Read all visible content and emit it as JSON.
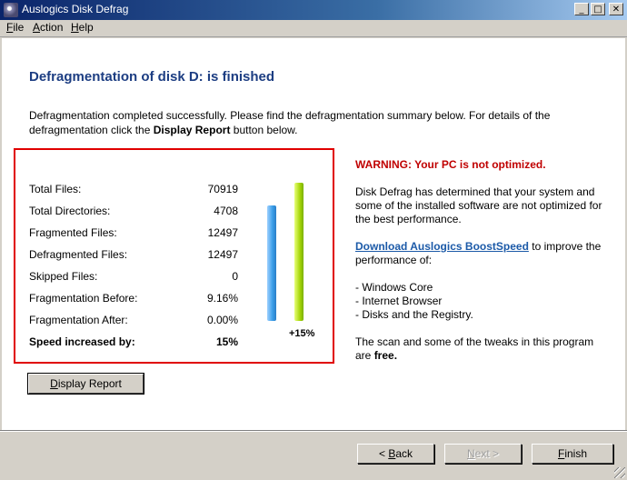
{
  "window": {
    "title": "Auslogics Disk Defrag",
    "minimize_glyph": "_",
    "maximize_glyph": "□",
    "close_glyph": "✕"
  },
  "menu": [
    {
      "first": "F",
      "rest": "ile"
    },
    {
      "first": "A",
      "rest": "ction"
    },
    {
      "first": "H",
      "rest": "elp"
    }
  ],
  "page": {
    "heading": "Defragmentation of disk D: is finished",
    "intro_text": "Defragmentation completed successfully. Please find the defragmentation summary below. For details of the defragmentation click the ",
    "intro_bold": "Display Report",
    "intro_end": " button below."
  },
  "stats": [
    {
      "label": "Total Files:",
      "value": "70919"
    },
    {
      "label": "Total Directories:",
      "value": "4708"
    },
    {
      "label": "Fragmented Files:",
      "value": "12497"
    },
    {
      "label": "Defragmented Files:",
      "value": "12497"
    },
    {
      "label": "Skipped Files:",
      "value": "0"
    },
    {
      "label": "Fragmentation Before:",
      "value": "9.16%"
    },
    {
      "label": "Fragmentation After:",
      "value": "0.00%"
    },
    {
      "label": "Speed increased by:",
      "value": "15%"
    }
  ],
  "bars": {
    "label": "+15%",
    "before_color": "#3a9ee8",
    "after_color": "#a6d60a"
  },
  "warning": {
    "title": "WARNING: Your PC is not optimized.",
    "body": "Disk Defrag has determined that your system and some of the installed software are not optimized for the best performance.",
    "link": "Download Auslogics BoostSpeed",
    "link_after": " to improve the performance of:",
    "items": [
      "- Windows Core",
      "- Internet Browser",
      "- Disks and the Registry."
    ],
    "footer_text": "The scan and some of the tweaks in this program are ",
    "footer_bold": "free."
  },
  "buttons": {
    "display_report_first": "D",
    "display_report_rest": "isplay Report",
    "back_prefix": "< ",
    "back_first": "B",
    "back_rest": "ack",
    "next_first": "N",
    "next_rest": "ext >",
    "finish_first": "F",
    "finish_rest": "inish"
  },
  "colors": {
    "heading": "#1c3d82",
    "warning": "#c00000",
    "link": "#1c5aa8",
    "highlight_border": "#e00000"
  }
}
